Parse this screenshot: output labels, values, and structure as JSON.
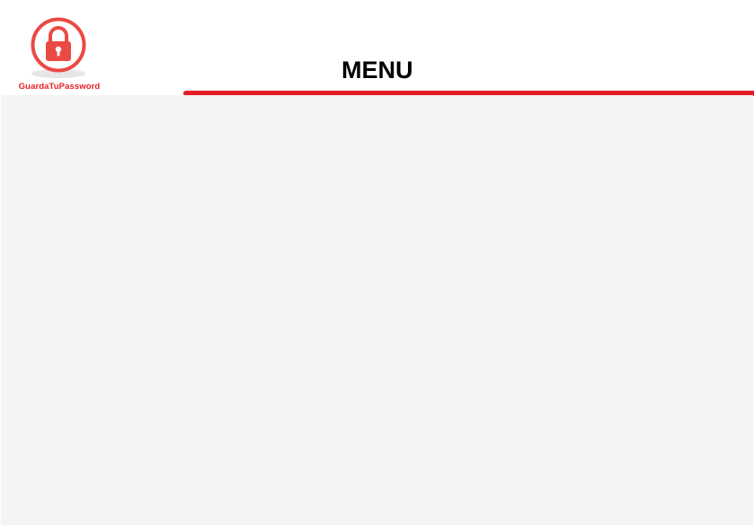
{
  "app": {
    "logo_text": "GuardaTuPassword",
    "logo_icon": "padlock-icon"
  },
  "header": {
    "title": "MENU"
  },
  "colors": {
    "brand_red": "#e31e24",
    "content_background": "#f4f4f4",
    "logo_circle": "#ea4a44"
  }
}
